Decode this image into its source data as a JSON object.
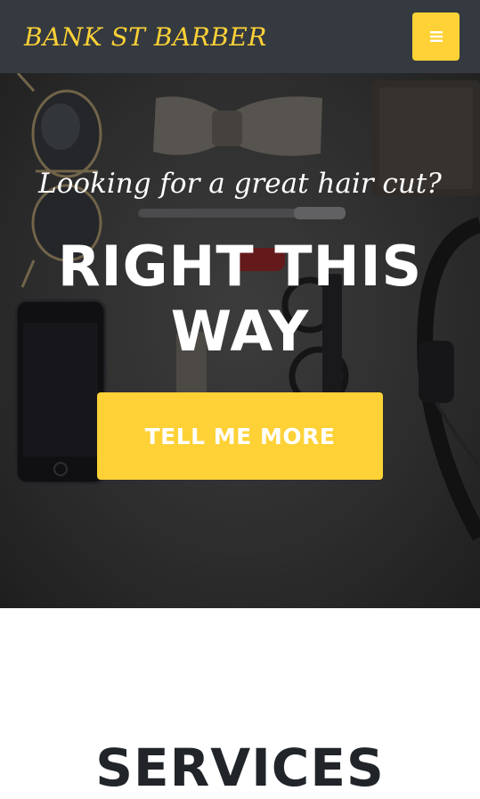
{
  "navbar": {
    "brand": "BANK ST BARBER",
    "menu_icon": "hamburger-menu-icon"
  },
  "hero": {
    "subheading": "Looking for a great hair cut?",
    "heading": "RIGHT THIS WAY",
    "cta_label": "TELL ME MORE"
  },
  "services": {
    "title": "SERVICES"
  },
  "colors": {
    "accent": "#fed136",
    "navbar_bg": "#343a40",
    "text_dark": "#212529",
    "white": "#ffffff"
  }
}
